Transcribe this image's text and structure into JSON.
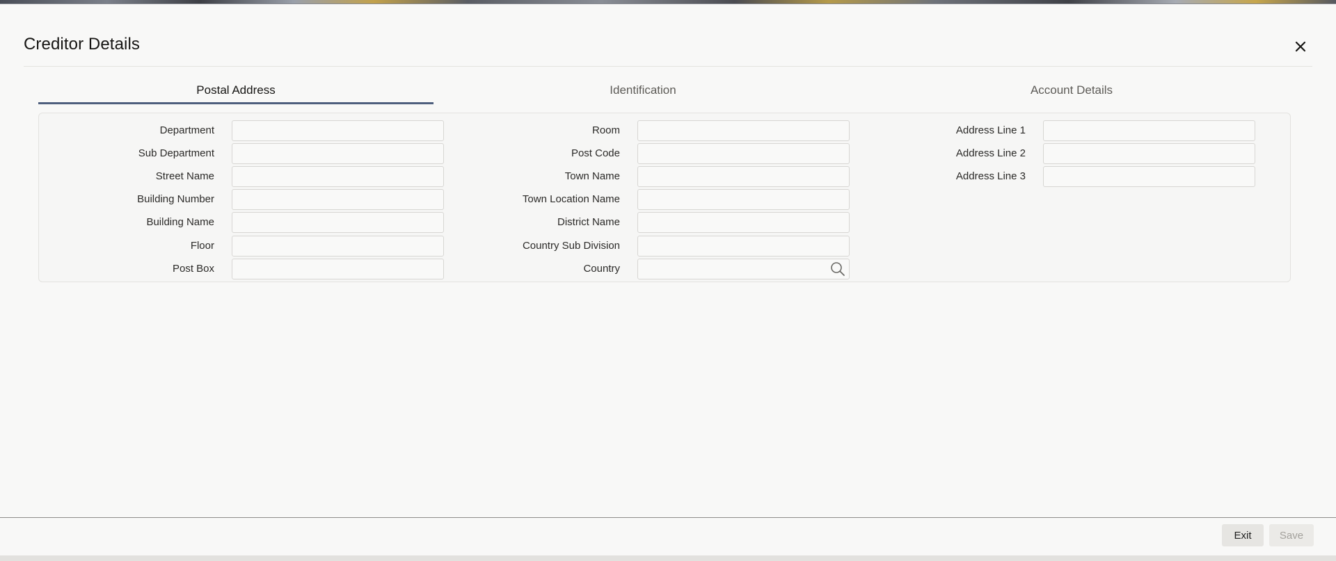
{
  "dialog": {
    "title": "Creditor Details",
    "close_icon": "close-icon"
  },
  "tabs": [
    {
      "label": "Postal Address",
      "active": true
    },
    {
      "label": "Identification",
      "active": false
    },
    {
      "label": "Account Details",
      "active": false
    }
  ],
  "form": {
    "col1": [
      {
        "label": "Department",
        "value": ""
      },
      {
        "label": "Sub Department",
        "value": ""
      },
      {
        "label": "Street Name",
        "value": ""
      },
      {
        "label": "Building Number",
        "value": ""
      },
      {
        "label": "Building Name",
        "value": ""
      },
      {
        "label": "Floor",
        "value": ""
      },
      {
        "label": "Post Box",
        "value": ""
      }
    ],
    "col2": [
      {
        "label": "Room",
        "value": ""
      },
      {
        "label": "Post Code",
        "value": ""
      },
      {
        "label": "Town Name",
        "value": ""
      },
      {
        "label": "Town Location Name",
        "value": ""
      },
      {
        "label": "District Name",
        "value": ""
      },
      {
        "label": "Country Sub Division",
        "value": ""
      },
      {
        "label": "Country",
        "value": "",
        "icon": "search-icon"
      }
    ],
    "col3": [
      {
        "label": "Address Line 1",
        "value": ""
      },
      {
        "label": "Address Line 2",
        "value": ""
      },
      {
        "label": "Address Line 3",
        "value": ""
      }
    ]
  },
  "footer": {
    "exit_label": "Exit",
    "save_label": "Save",
    "save_enabled": false
  },
  "colors": {
    "active_tab_underline": "#4e5f7d",
    "panel_border": "#e3e2df"
  }
}
